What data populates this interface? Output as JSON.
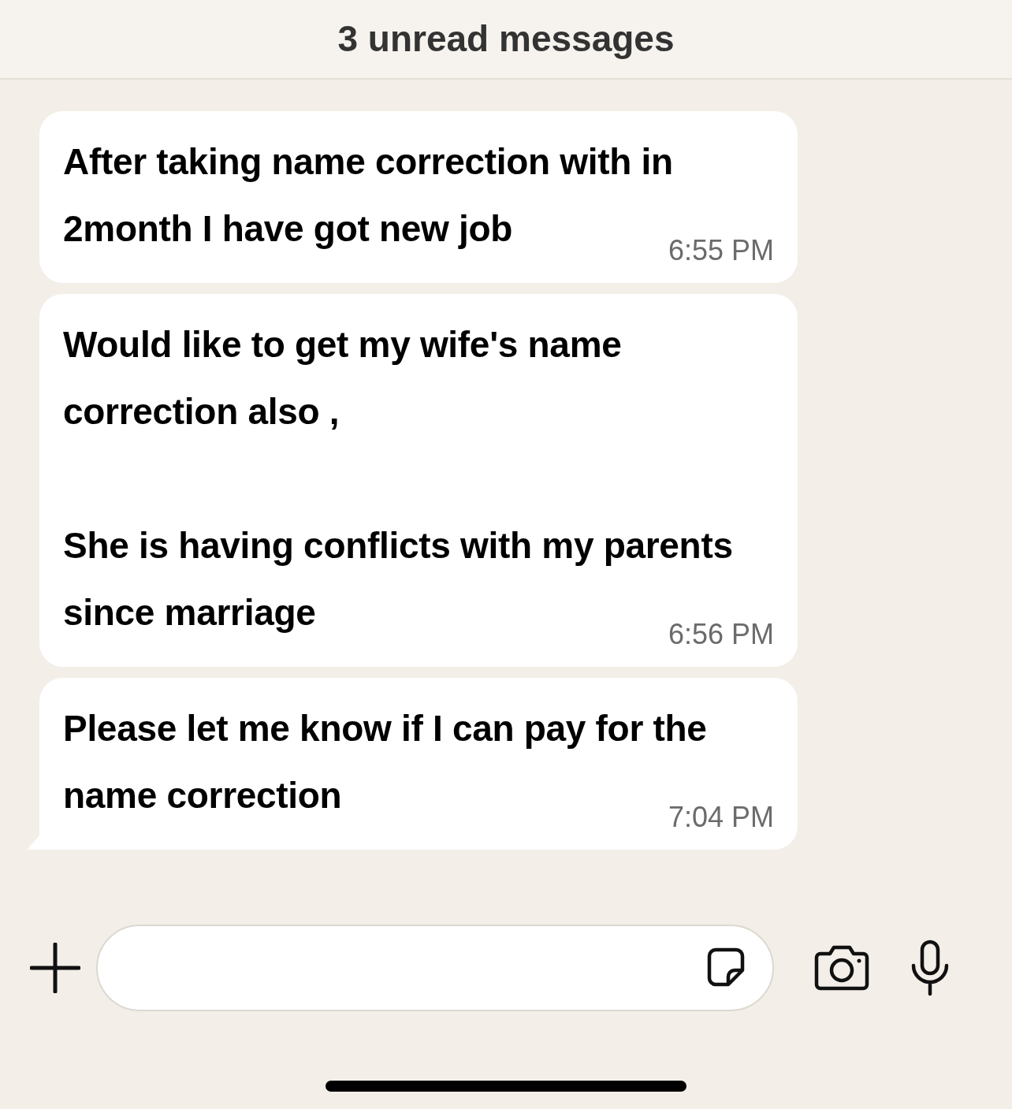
{
  "banner": {
    "text": "3 unread messages"
  },
  "messages": [
    {
      "text": "After taking name correction with in 2month I have got new job",
      "time": "6:55 PM",
      "tail": false
    },
    {
      "text": "Would like to get my wife's name correction also ,\n\nShe is having conflicts with my parents since marriage",
      "time": "6:56 PM",
      "tail": false
    },
    {
      "text": "Please let me know if I can pay for the name correction",
      "time": "7:04 PM",
      "tail": true
    }
  ]
}
